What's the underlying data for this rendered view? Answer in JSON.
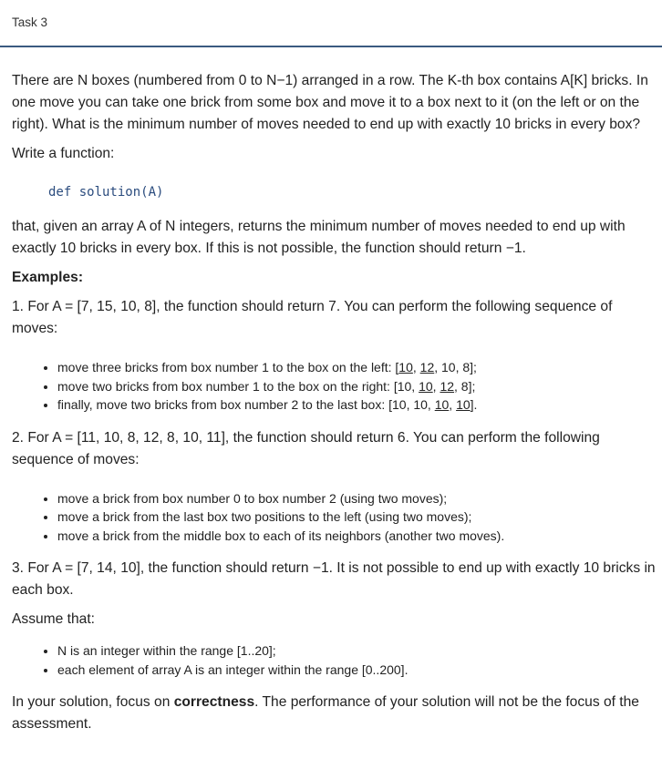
{
  "header": {
    "title": "Task 3"
  },
  "intro": "There are N boxes (numbered from 0 to N−1) arranged in a row. The K-th box contains A[K] bricks. In one move you can take one brick from some box and move it to a box next to it (on the left or on the right). What is the minimum number of moves needed to end up with exactly 10 bricks in every box?",
  "write_function": "Write a function:",
  "code": "def solution(A)",
  "given": "that, given an array A of N integers, returns the minimum number of moves needed to end up with exactly 10 bricks in every box. If this is not possible, the function should return −1.",
  "examples_heading": "Examples:",
  "example1": {
    "text": "1. For A = [7, 15, 10, 8], the function should return 7. You can perform the following sequence of moves:",
    "moves": [
      {
        "prefix": "move three bricks from box number 1 to the box on the left: [",
        "u1": "10",
        "mid1": ", ",
        "u2": "12",
        "suffix": ", 10, 8];"
      },
      {
        "prefix": "move two bricks from box number 1 to the box on the right: [10, ",
        "u1": "10",
        "mid1": ", ",
        "u2": "12",
        "suffix": ", 8];"
      },
      {
        "prefix": "finally, move two bricks from box number 2 to the last box: [10, 10, ",
        "u1": "10",
        "mid1": ", ",
        "u2": "10",
        "suffix": "]."
      }
    ]
  },
  "example2": {
    "text": "2. For A = [11, 10, 8, 12, 8, 10, 11], the function should return 6. You can perform the following sequence of moves:",
    "moves": [
      "move a brick from box number 0 to box number 2 (using two moves);",
      "move a brick from the last box two positions to the left (using two moves);",
      "move a brick from the middle box to each of its neighbors (another two moves)."
    ]
  },
  "example3": {
    "text": "3. For A = [7, 14, 10], the function should return −1. It is not possible to end up with exactly 10 bricks in each box."
  },
  "assume_heading": "Assume that:",
  "assumptions": [
    "N is an integer within the range [1..20];",
    "each element of array A is an integer within the range [0..200]."
  ],
  "focus": {
    "before": "In your solution, focus on ",
    "bold": "correctness",
    "after": ". The performance of your solution will not be the focus of the assessment."
  }
}
